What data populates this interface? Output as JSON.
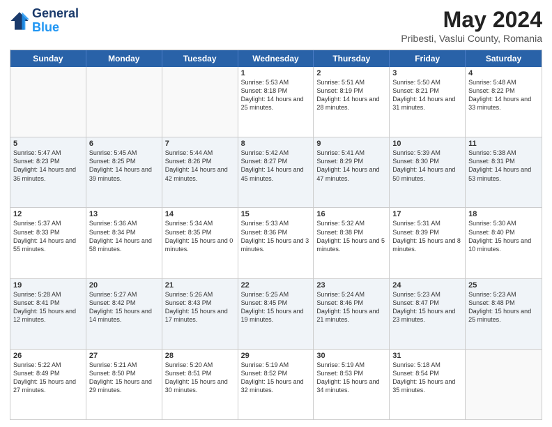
{
  "header": {
    "logo": {
      "line1": "General",
      "line2": "Blue"
    },
    "title": "May 2024",
    "subtitle": "Pribesti, Vaslui County, Romania"
  },
  "dayHeaders": [
    "Sunday",
    "Monday",
    "Tuesday",
    "Wednesday",
    "Thursday",
    "Friday",
    "Saturday"
  ],
  "rows": [
    {
      "alt": false,
      "cells": [
        {
          "day": "",
          "info": ""
        },
        {
          "day": "",
          "info": ""
        },
        {
          "day": "",
          "info": ""
        },
        {
          "day": "1",
          "info": "Sunrise: 5:53 AM\nSunset: 8:18 PM\nDaylight: 14 hours and 25 minutes."
        },
        {
          "day": "2",
          "info": "Sunrise: 5:51 AM\nSunset: 8:19 PM\nDaylight: 14 hours and 28 minutes."
        },
        {
          "day": "3",
          "info": "Sunrise: 5:50 AM\nSunset: 8:21 PM\nDaylight: 14 hours and 31 minutes."
        },
        {
          "day": "4",
          "info": "Sunrise: 5:48 AM\nSunset: 8:22 PM\nDaylight: 14 hours and 33 minutes."
        }
      ]
    },
    {
      "alt": true,
      "cells": [
        {
          "day": "5",
          "info": "Sunrise: 5:47 AM\nSunset: 8:23 PM\nDaylight: 14 hours and 36 minutes."
        },
        {
          "day": "6",
          "info": "Sunrise: 5:45 AM\nSunset: 8:25 PM\nDaylight: 14 hours and 39 minutes."
        },
        {
          "day": "7",
          "info": "Sunrise: 5:44 AM\nSunset: 8:26 PM\nDaylight: 14 hours and 42 minutes."
        },
        {
          "day": "8",
          "info": "Sunrise: 5:42 AM\nSunset: 8:27 PM\nDaylight: 14 hours and 45 minutes."
        },
        {
          "day": "9",
          "info": "Sunrise: 5:41 AM\nSunset: 8:29 PM\nDaylight: 14 hours and 47 minutes."
        },
        {
          "day": "10",
          "info": "Sunrise: 5:39 AM\nSunset: 8:30 PM\nDaylight: 14 hours and 50 minutes."
        },
        {
          "day": "11",
          "info": "Sunrise: 5:38 AM\nSunset: 8:31 PM\nDaylight: 14 hours and 53 minutes."
        }
      ]
    },
    {
      "alt": false,
      "cells": [
        {
          "day": "12",
          "info": "Sunrise: 5:37 AM\nSunset: 8:33 PM\nDaylight: 14 hours and 55 minutes."
        },
        {
          "day": "13",
          "info": "Sunrise: 5:36 AM\nSunset: 8:34 PM\nDaylight: 14 hours and 58 minutes."
        },
        {
          "day": "14",
          "info": "Sunrise: 5:34 AM\nSunset: 8:35 PM\nDaylight: 15 hours and 0 minutes."
        },
        {
          "day": "15",
          "info": "Sunrise: 5:33 AM\nSunset: 8:36 PM\nDaylight: 15 hours and 3 minutes."
        },
        {
          "day": "16",
          "info": "Sunrise: 5:32 AM\nSunset: 8:38 PM\nDaylight: 15 hours and 5 minutes."
        },
        {
          "day": "17",
          "info": "Sunrise: 5:31 AM\nSunset: 8:39 PM\nDaylight: 15 hours and 8 minutes."
        },
        {
          "day": "18",
          "info": "Sunrise: 5:30 AM\nSunset: 8:40 PM\nDaylight: 15 hours and 10 minutes."
        }
      ]
    },
    {
      "alt": true,
      "cells": [
        {
          "day": "19",
          "info": "Sunrise: 5:28 AM\nSunset: 8:41 PM\nDaylight: 15 hours and 12 minutes."
        },
        {
          "day": "20",
          "info": "Sunrise: 5:27 AM\nSunset: 8:42 PM\nDaylight: 15 hours and 14 minutes."
        },
        {
          "day": "21",
          "info": "Sunrise: 5:26 AM\nSunset: 8:43 PM\nDaylight: 15 hours and 17 minutes."
        },
        {
          "day": "22",
          "info": "Sunrise: 5:25 AM\nSunset: 8:45 PM\nDaylight: 15 hours and 19 minutes."
        },
        {
          "day": "23",
          "info": "Sunrise: 5:24 AM\nSunset: 8:46 PM\nDaylight: 15 hours and 21 minutes."
        },
        {
          "day": "24",
          "info": "Sunrise: 5:23 AM\nSunset: 8:47 PM\nDaylight: 15 hours and 23 minutes."
        },
        {
          "day": "25",
          "info": "Sunrise: 5:23 AM\nSunset: 8:48 PM\nDaylight: 15 hours and 25 minutes."
        }
      ]
    },
    {
      "alt": false,
      "cells": [
        {
          "day": "26",
          "info": "Sunrise: 5:22 AM\nSunset: 8:49 PM\nDaylight: 15 hours and 27 minutes."
        },
        {
          "day": "27",
          "info": "Sunrise: 5:21 AM\nSunset: 8:50 PM\nDaylight: 15 hours and 29 minutes."
        },
        {
          "day": "28",
          "info": "Sunrise: 5:20 AM\nSunset: 8:51 PM\nDaylight: 15 hours and 30 minutes."
        },
        {
          "day": "29",
          "info": "Sunrise: 5:19 AM\nSunset: 8:52 PM\nDaylight: 15 hours and 32 minutes."
        },
        {
          "day": "30",
          "info": "Sunrise: 5:19 AM\nSunset: 8:53 PM\nDaylight: 15 hours and 34 minutes."
        },
        {
          "day": "31",
          "info": "Sunrise: 5:18 AM\nSunset: 8:54 PM\nDaylight: 15 hours and 35 minutes."
        },
        {
          "day": "",
          "info": ""
        }
      ]
    }
  ]
}
